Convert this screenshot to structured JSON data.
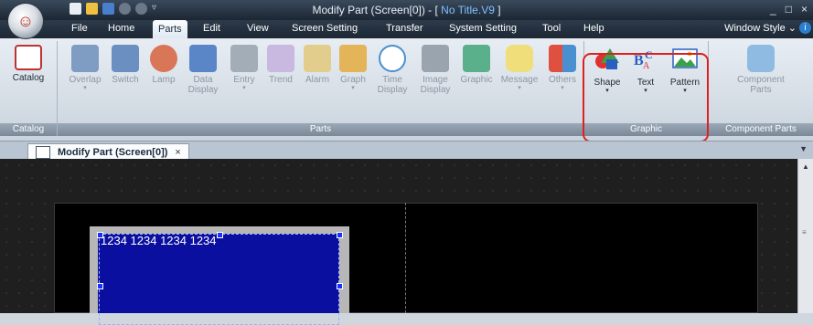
{
  "window": {
    "title_prefix": "Modify Part (Screen[0]) - [ ",
    "title_doc": "No Title.V9",
    "title_suffix": " ]",
    "controls": [
      "_",
      "□",
      "×"
    ]
  },
  "menu": {
    "items": [
      "File",
      "Home",
      "Parts",
      "Edit",
      "View",
      "Screen Setting",
      "Transfer",
      "System Setting",
      "Tool",
      "Help"
    ],
    "active": "Parts",
    "window_style": "Window Style"
  },
  "ribbon": {
    "groups": {
      "catalog": {
        "label": "Catalog",
        "buttons": [
          {
            "label": "Catalog",
            "icon": "book-icon",
            "color": "#c03030"
          }
        ]
      },
      "parts": {
        "label": "Parts",
        "buttons": [
          {
            "label": "Overlap",
            "icon": "overlap-icon",
            "color": "#6d8fb8"
          },
          {
            "label": "Switch",
            "icon": "switch-icon",
            "color": "#5f84b5"
          },
          {
            "label": "Lamp",
            "icon": "lamp-icon",
            "color": "#d56a45"
          },
          {
            "label": "Data",
            "label2": "Display",
            "icon": "data-display-icon",
            "color": "#4a78c0"
          },
          {
            "label": "Entry",
            "icon": "entry-icon",
            "color": "#8f9aa6"
          },
          {
            "label": "Trend",
            "icon": "trend-icon",
            "color": "#a080c0"
          },
          {
            "label": "Alarm",
            "icon": "alarm-icon",
            "color": "#d0b060"
          },
          {
            "label": "Graph",
            "icon": "graph-icon",
            "color": "#d9a640"
          },
          {
            "label": "Time",
            "label2": "Display",
            "icon": "clock-icon",
            "color": "#4d8fd0"
          },
          {
            "label": "Image",
            "label2": "Display",
            "icon": "camera-icon",
            "color": "#8a95a0"
          },
          {
            "label": "Graphic",
            "icon": "graphic-icon",
            "color": "#3a9a70"
          },
          {
            "label": "Message",
            "icon": "message-icon",
            "color": "#e8d050"
          },
          {
            "label": "Others",
            "icon": "others-icon",
            "color": "#e05040"
          }
        ]
      },
      "graphic": {
        "label": "Graphic",
        "buttons": [
          {
            "label": "Shape",
            "icon": "shape-icon",
            "color": "#e03030"
          },
          {
            "label": "Text",
            "icon": "text-icon",
            "color": "#2a5fc0"
          },
          {
            "label": "Pattern",
            "icon": "pattern-icon",
            "color": "#3aa04a"
          }
        ]
      },
      "component_parts": {
        "label": "Component Parts",
        "buttons": [
          {
            "label": "Component",
            "label2": "Parts",
            "icon": "puzzle-icon",
            "color": "#5b9bd5"
          }
        ]
      }
    },
    "highlight_color": "#e02020"
  },
  "document_tab": {
    "label": "Modify Part (Screen[0])",
    "close": "×"
  },
  "canvas": {
    "part_text": "1234 1234 1234 1234"
  }
}
